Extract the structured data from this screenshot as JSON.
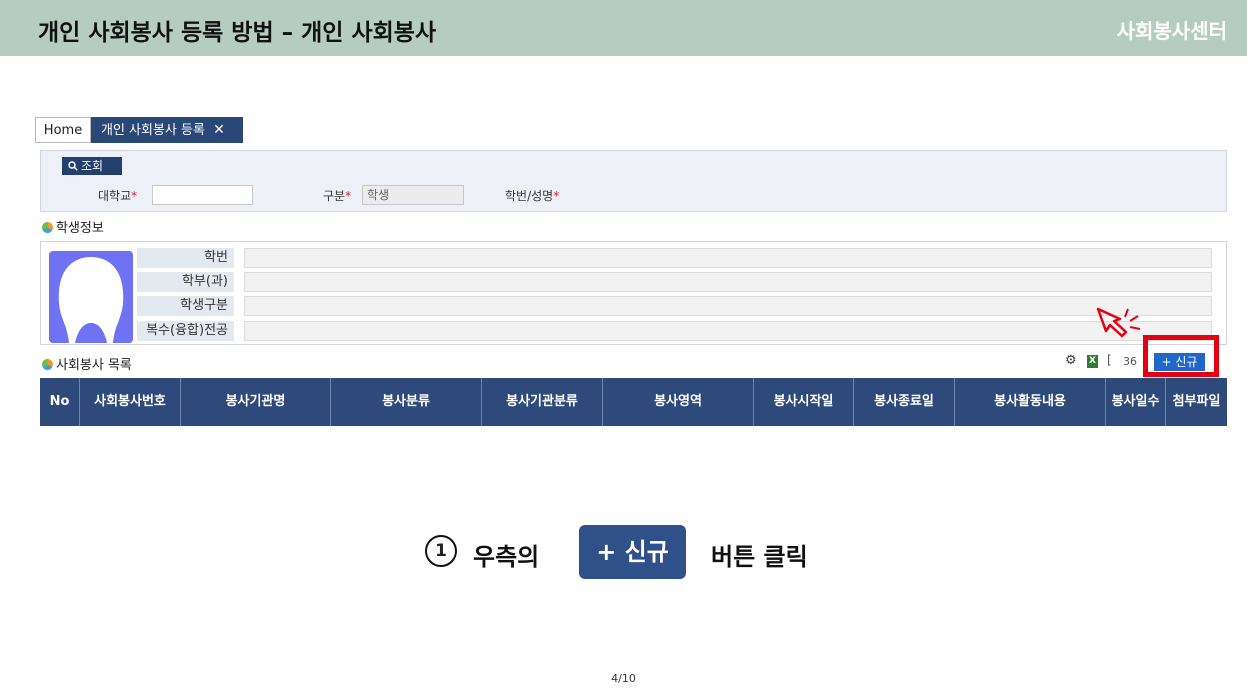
{
  "slide": {
    "title": "개인 사회봉사 등록 방법 – 개인 사회봉사",
    "brand": "사회봉사센터",
    "page": "4/10"
  },
  "tabs": {
    "home": "Home",
    "active": "개인 사회봉사 등록",
    "close": "✕"
  },
  "search": {
    "button_label": "조회",
    "fields": {
      "univ_label": "대학교",
      "type_label": "구분",
      "type_value": "학생",
      "id_label": "학번/성명",
      "required_mark": "*"
    }
  },
  "student_info": {
    "title": "학생정보",
    "rows": [
      "학번",
      "학부(과)",
      "학생구분",
      "복수(융합)전공"
    ]
  },
  "volunteer_list": {
    "title": "사회봉사 목록",
    "bracket": "[",
    "count": "36",
    "new_button": "+ 신규",
    "columns": [
      "No",
      "사회봉사번호",
      "봉사기관명",
      "봉사분류",
      "봉사기관분류",
      "봉사영역",
      "봉사시작일",
      "봉사종료일",
      "봉사활동내용",
      "봉사일수",
      "첨부파일"
    ]
  },
  "instruction": {
    "number": "1",
    "prefix": "우측의",
    "button": "+ 신규",
    "suffix": "버튼 클릭"
  },
  "colors": {
    "header_bg": "#b5cdc0",
    "navy": "#2e4a7a",
    "new_button": "#1f68c8",
    "highlight": "#e60012",
    "avatar": "#6f72f2"
  },
  "icons": [
    "search-icon",
    "gear-icon",
    "excel-icon",
    "pointer-icon",
    "section-icon"
  ]
}
